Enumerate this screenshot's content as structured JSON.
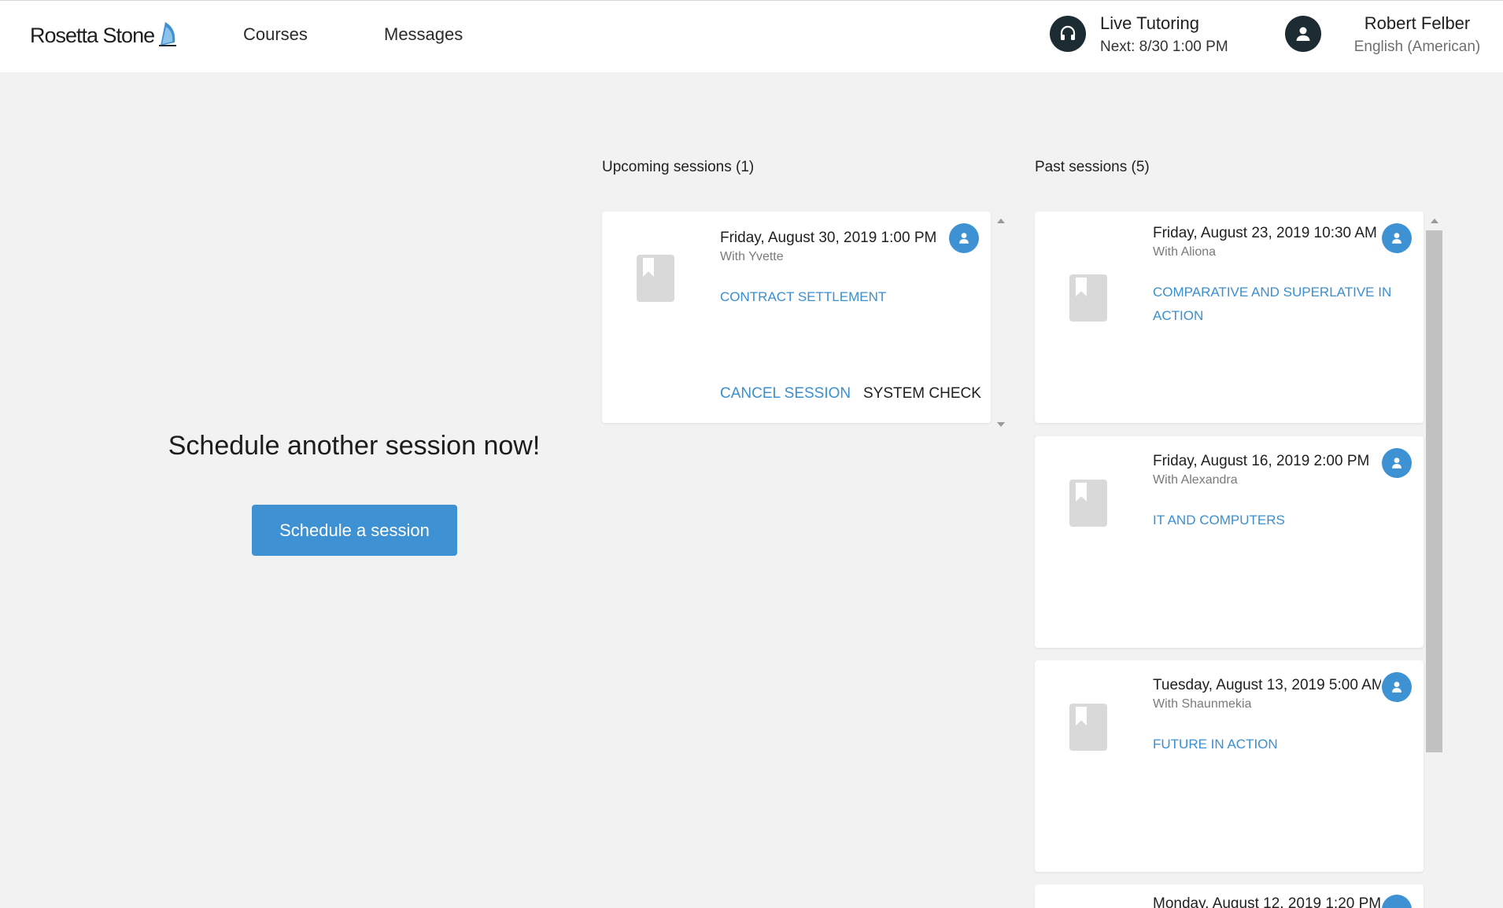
{
  "header": {
    "logo_text": "Rosetta Stone",
    "nav": {
      "courses": "Courses",
      "messages": "Messages"
    },
    "tutoring": {
      "title": "Live Tutoring",
      "next": "Next: 8/30 1:00 PM",
      "icon": "headset-icon"
    },
    "user": {
      "name": "Robert Felber",
      "language": "English (American)",
      "icon": "user-icon"
    }
  },
  "promo": {
    "title": "Schedule another session now!",
    "button": "Schedule a session"
  },
  "upcoming": {
    "heading": "Upcoming sessions (1)",
    "sessions": [
      {
        "date": "Friday, August 30, 2019 1:00 PM",
        "with": "With Yvette",
        "topic": "CONTRACT SETTLEMENT",
        "cancel": "CANCEL SESSION",
        "system_check": "SYSTEM CHECK"
      }
    ]
  },
  "past": {
    "heading": "Past sessions (5)",
    "sessions": [
      {
        "date": "Friday, August 23, 2019 10:30 AM",
        "with": "With Aliona",
        "topic_line1": "COMPARATIVE AND SUPERLATIVE IN",
        "topic_line2": "ACTION"
      },
      {
        "date": "Friday, August 16, 2019 2:00 PM",
        "with": "With Alexandra",
        "topic": "IT AND COMPUTERS"
      },
      {
        "date": "Tuesday, August 13, 2019 5:00 AM",
        "with": "With Shaunmekia",
        "topic": "FUTURE IN ACTION"
      },
      {
        "date": "Monday, August 12, 2019 1:20 PM"
      }
    ]
  },
  "colors": {
    "accent": "#3e92d3",
    "link": "#3a8fd0",
    "dark_icon_bg": "#1d2b33",
    "page_bg": "#f2f2f2"
  }
}
